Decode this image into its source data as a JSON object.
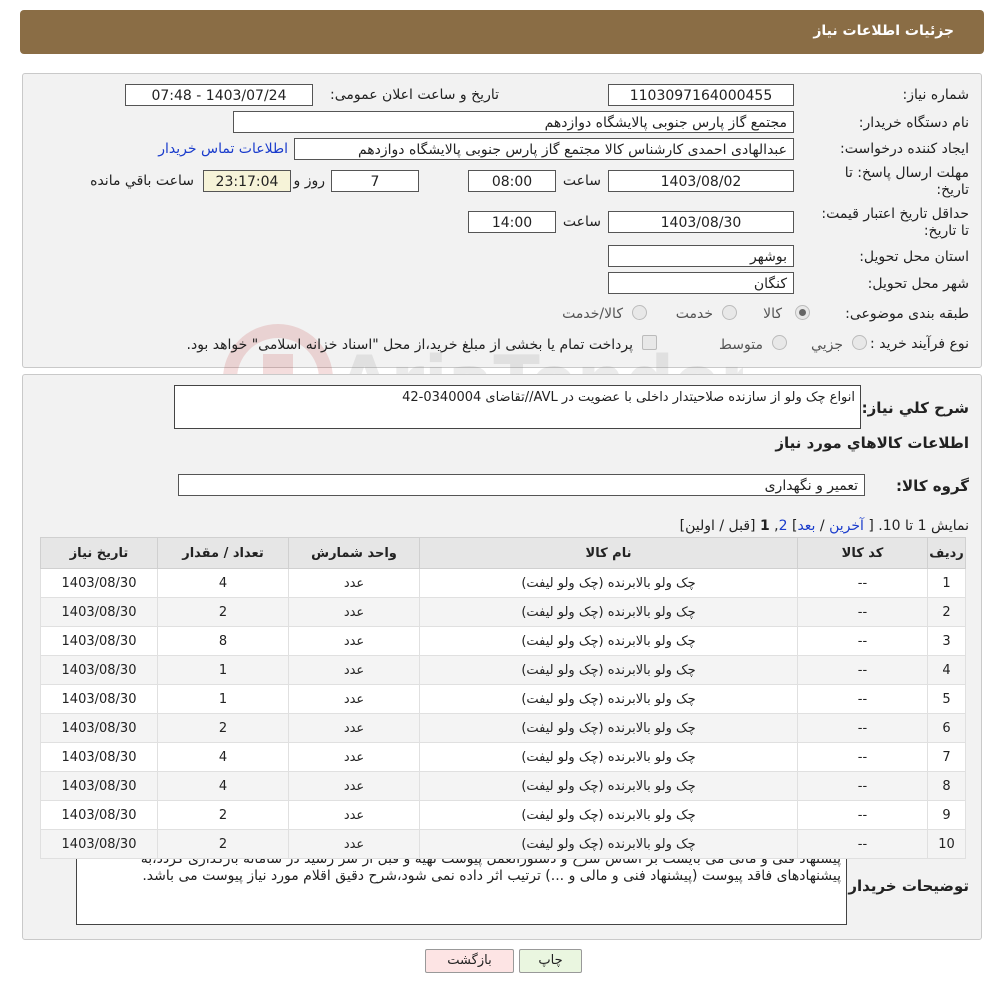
{
  "header": {
    "title": "جزئیات اطلاعات نیاز"
  },
  "form": {
    "need_number_label": "شماره نیاز:",
    "need_number": "1103097164000455",
    "announce_label": "تاریخ و ساعت اعلان عمومی:",
    "announce_value": "1403/07/24 - 07:48",
    "buyer_org_label": "نام دستگاه خریدار:",
    "buyer_org": "مجتمع گاز پارس جنوبی  پالایشگاه دوازدهم",
    "creator_label": "ایجاد کننده درخواست:",
    "creator": "عبدالهادی احمدی کارشناس کالا مجتمع گاز پارس جنوبی  پالایشگاه دوازدهم",
    "contact_link": "اطلاعات تماس خریدار",
    "deadline_label": "مهلت ارسال پاسخ: تا تاریخ:",
    "deadline_date": "1403/08/02",
    "time_label": "ساعت",
    "deadline_time": "08:00",
    "days_value": "7",
    "days_label": "روز و",
    "remaining_time": "23:17:04",
    "remaining_label": "ساعت باقي مانده",
    "validity_label": "حداقل تاریخ اعتبار قیمت: تا تاریخ:",
    "validity_date": "1403/08/30",
    "validity_time": "14:00",
    "province_label": "استان محل تحویل:",
    "province": "بوشهر",
    "city_label": "شهر محل تحویل:",
    "city": "کنگان",
    "category_label": "طبقه بندی موضوعی:",
    "category_options": [
      "کالا",
      "خدمت",
      "کالا/خدمت"
    ],
    "process_label": "نوع فرآیند خرید :",
    "process_options": [
      "جزيي",
      "متوسط"
    ],
    "process_note": "پرداخت تمام یا بخشی از مبلغ خرید،از محل \"اسناد خزانه اسلامی\" خواهد بود."
  },
  "details": {
    "summary_label": "شرح کلي نياز:",
    "summary": "انواع چک ولو از سازنده صلاحیتدار داخلی با عضویت در AVL//تقاضای 0340004-42",
    "items_title": "اطلاعات کالاهاي مورد نياز",
    "group_label": "گروه کالا:",
    "group_value": "تعمیر و نگهداری",
    "pagination": {
      "prefix": "نمايش 1 تا 10.",
      "open": "[",
      "last": "آخرین",
      "sep1": "/",
      "next": "بعد",
      "close": "]",
      "page2": "2",
      "comma": ",",
      "page1": "1",
      "tail": "[قبل / اولین]"
    },
    "columns": [
      "رديف",
      "کد کالا",
      "نام کالا",
      "واحد شمارش",
      "تعداد / مقدار",
      "تاریخ نیاز"
    ],
    "rows": [
      [
        "1",
        "--",
        "چک ولو بالابرنده (چک ولو لیفت)",
        "عدد",
        "4",
        "1403/08/30"
      ],
      [
        "2",
        "--",
        "چک ولو بالابرنده (چک ولو لیفت)",
        "عدد",
        "2",
        "1403/08/30"
      ],
      [
        "3",
        "--",
        "چک ولو بالابرنده (چک ولو لیفت)",
        "عدد",
        "8",
        "1403/08/30"
      ],
      [
        "4",
        "--",
        "چک ولو بالابرنده (چک ولو لیفت)",
        "عدد",
        "1",
        "1403/08/30"
      ],
      [
        "5",
        "--",
        "چک ولو بالابرنده (چک ولو لیفت)",
        "عدد",
        "1",
        "1403/08/30"
      ],
      [
        "6",
        "--",
        "چک ولو بالابرنده (چک ولو لیفت)",
        "عدد",
        "2",
        "1403/08/30"
      ],
      [
        "7",
        "--",
        "چک ولو بالابرنده (چک ولو لیفت)",
        "عدد",
        "4",
        "1403/08/30"
      ],
      [
        "8",
        "--",
        "چک ولو بالابرنده (چک ولو لیفت)",
        "عدد",
        "4",
        "1403/08/30"
      ],
      [
        "9",
        "--",
        "چک ولو بالابرنده (چک ولو لیفت)",
        "عدد",
        "2",
        "1403/08/30"
      ],
      [
        "10",
        "--",
        "چک ولو بالابرنده (چک ولو لیفت)",
        "عدد",
        "2",
        "1403/08/30"
      ]
    ],
    "notes_label": "توضیحات خریدار:",
    "notes": "پیشنهاد فنی و مالی می بایست بر اساس شرح و دستورالعمل پیوست تهیه و قبل از سر رسید در سامانه بارگذاری گردد،به پیشنهادهای فاقد پیوست (پیشنهاد فنی و مالی و ...) ترتیب اثر داده نمی شود،شرح دقیق اقلام مورد نیاز پیوست می باشد."
  },
  "buttons": {
    "print": "چاپ",
    "back": "بازگشت"
  },
  "watermark": "AriaTender.neT"
}
